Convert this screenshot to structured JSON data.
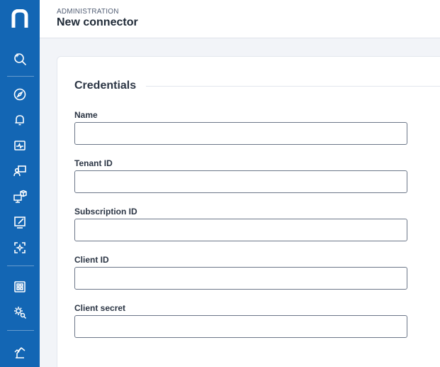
{
  "app": {
    "logo_letter": "n"
  },
  "sidebar": {
    "icons": [
      "search-sparkle-icon",
      "compass-icon",
      "bell-icon",
      "activity-monitor-icon",
      "users-presentation-icon",
      "devices-cube-icon",
      "edit-display-icon",
      "scan-sparkle-icon",
      "apps-grid-icon",
      "gear-search-icon",
      "crane-icon"
    ]
  },
  "header": {
    "eyebrow": "ADMINISTRATION",
    "title": "New connector"
  },
  "form": {
    "section_title": "Credentials",
    "fields": [
      {
        "label": "Name",
        "value": ""
      },
      {
        "label": "Tenant ID",
        "value": ""
      },
      {
        "label": "Subscription ID",
        "value": ""
      },
      {
        "label": "Client ID",
        "value": ""
      },
      {
        "label": "Client secret",
        "value": ""
      }
    ]
  },
  "colors": {
    "sidebar": "#1366b4",
    "background": "#f2f4f8",
    "input_border": "#6b7688"
  }
}
